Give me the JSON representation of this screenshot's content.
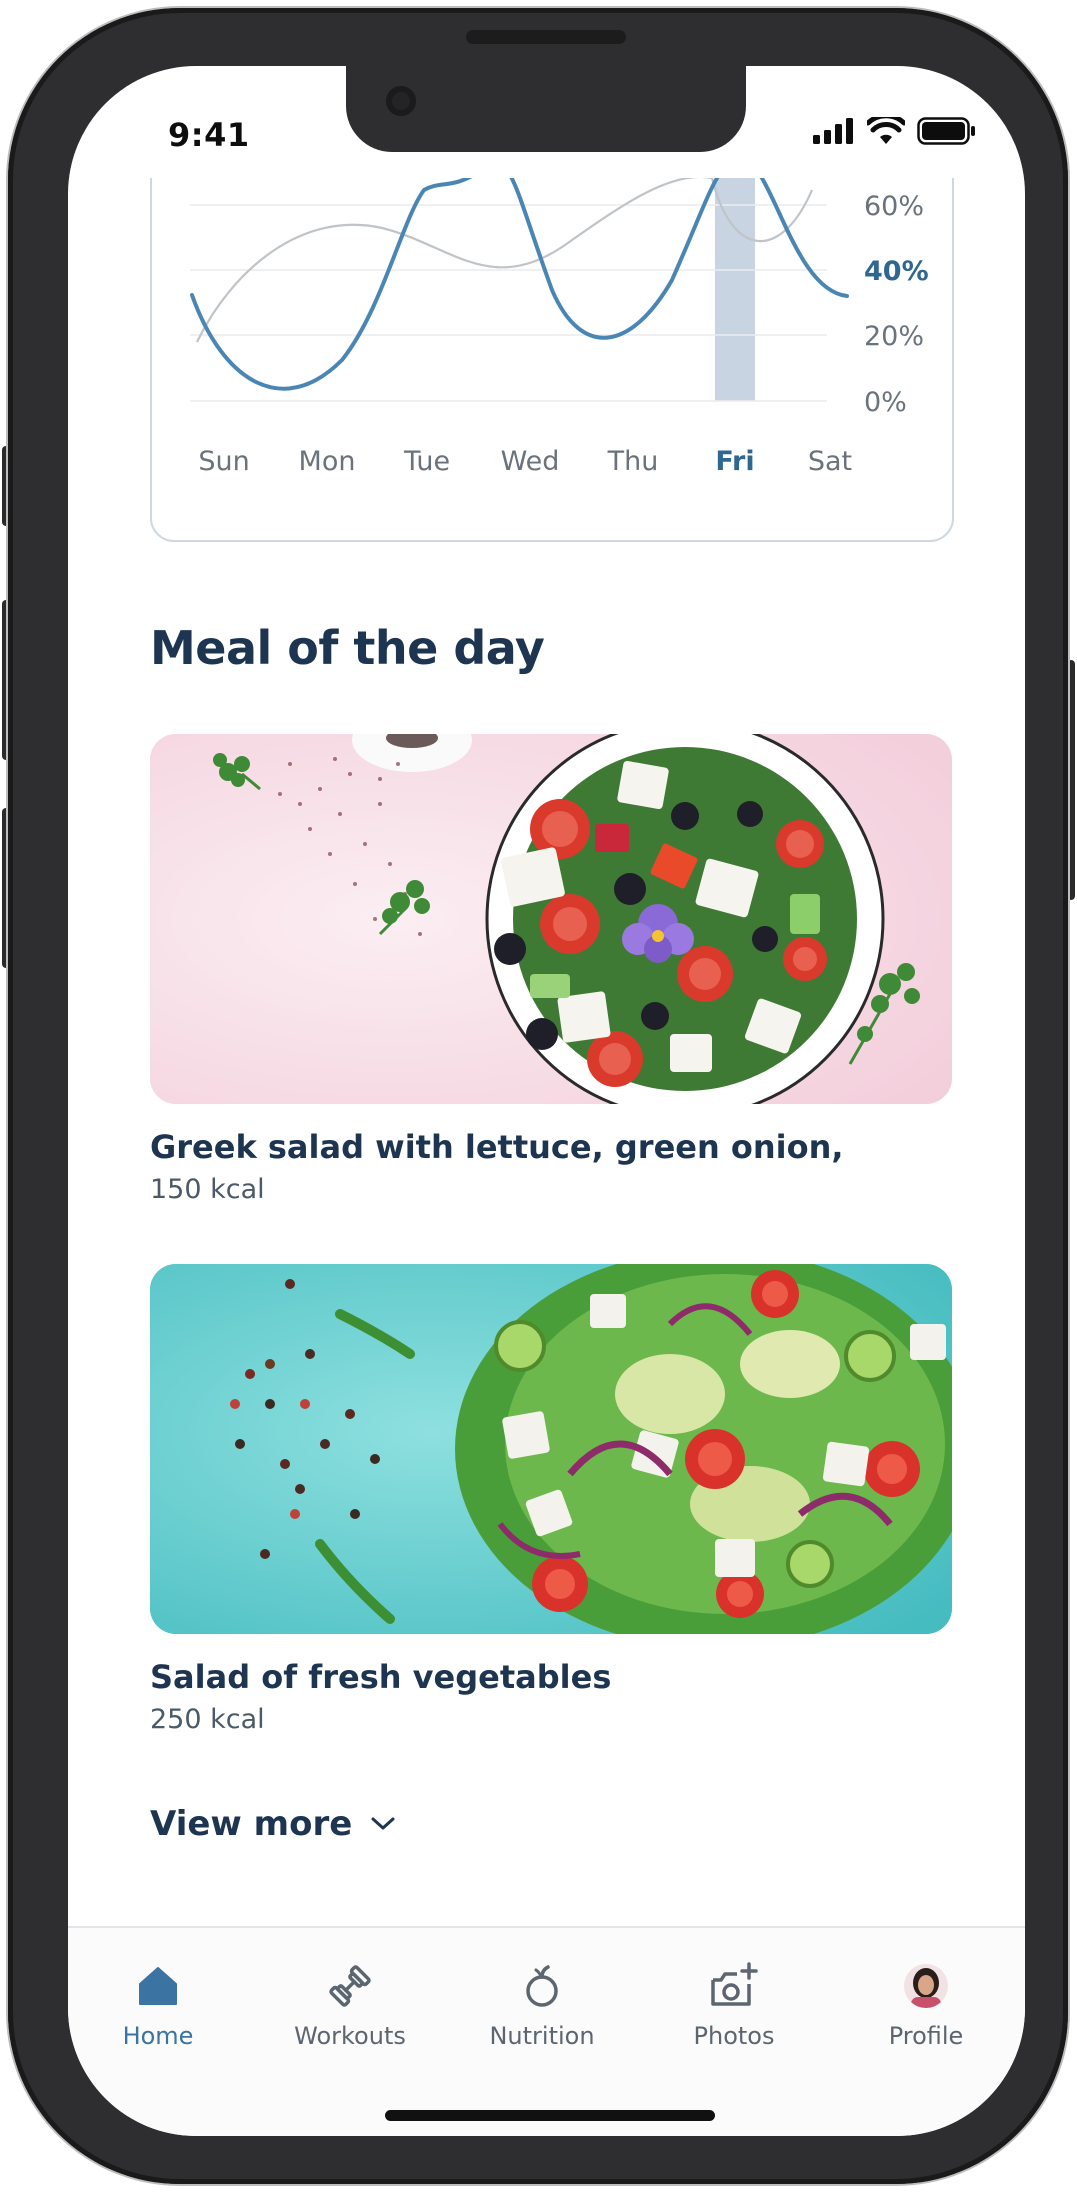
{
  "status_bar": {
    "time": "9:41"
  },
  "chart": {
    "y_ticks": [
      "60%",
      "40%",
      "20%",
      "0%"
    ],
    "y_highlight": "40%",
    "days": [
      "Sun",
      "Mon",
      "Tue",
      "Wed",
      "Thu",
      "Fri",
      "Sat"
    ],
    "selected_day": "Fri",
    "accent_color": "#4a86b4",
    "secondary_color": "#bfc4c8",
    "highlight_bar_color": "#c9d4e2"
  },
  "meal_section": {
    "title": "Meal of the day",
    "meals": [
      {
        "name": "Greek salad with lettuce, green onion,",
        "kcal": "150 kcal",
        "image": "greek-salad-bowl-on-pink"
      },
      {
        "name": "Salad of fresh vegetables",
        "kcal": "250 kcal",
        "image": "arugula-tomato-feta-salad-on-turquoise"
      }
    ],
    "view_more": "View more"
  },
  "tab_bar": {
    "items": [
      {
        "label": "Home",
        "icon": "home-icon",
        "active": true
      },
      {
        "label": "Workouts",
        "icon": "dumbbell-icon",
        "active": false
      },
      {
        "label": "Nutrition",
        "icon": "apple-icon",
        "active": false
      },
      {
        "label": "Photos",
        "icon": "camera-plus-icon",
        "active": false
      },
      {
        "label": "Profile",
        "icon": "avatar",
        "active": false
      }
    ],
    "active_color": "#3b73a3",
    "inactive_color": "#5c6670"
  }
}
